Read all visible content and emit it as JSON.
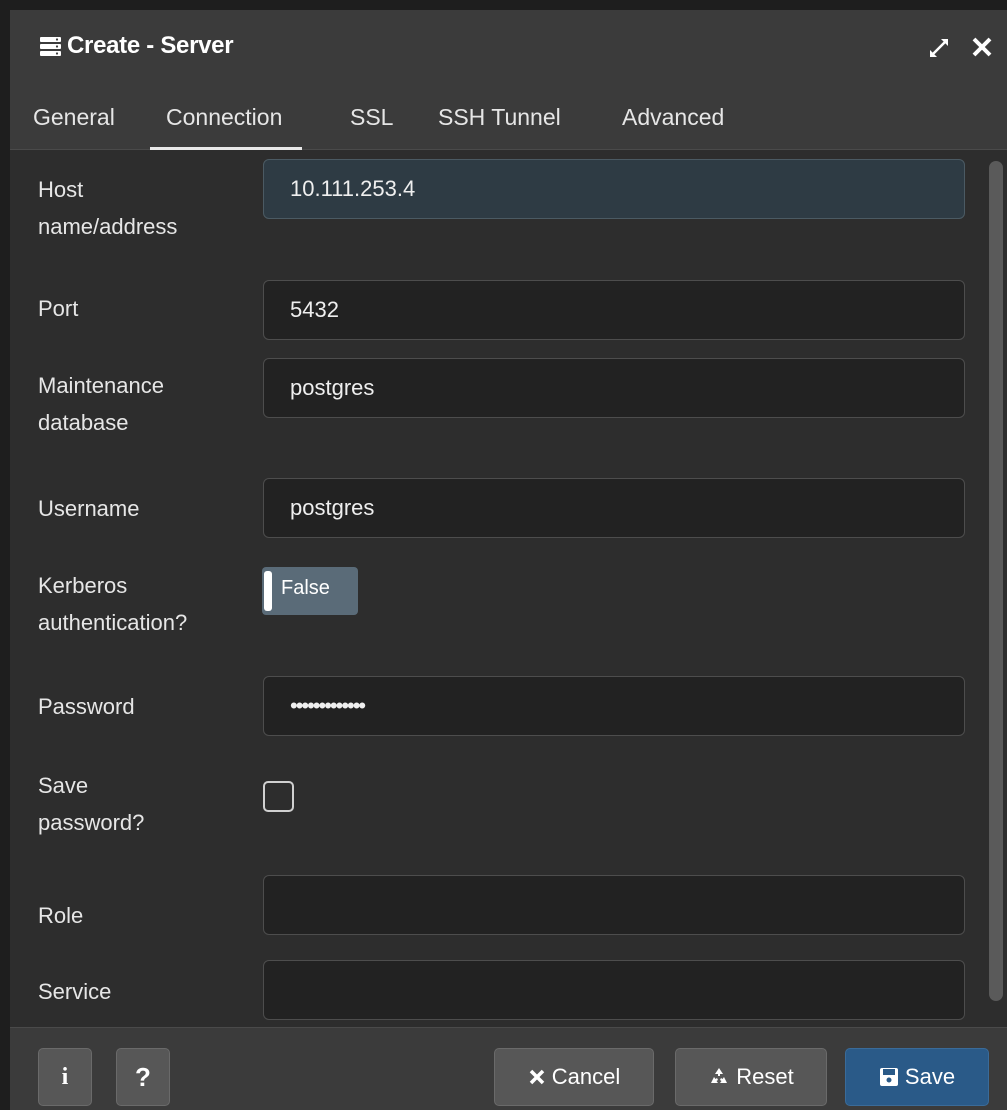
{
  "dialog": {
    "title": "Create - Server"
  },
  "tabs": [
    {
      "label": "General",
      "active": false
    },
    {
      "label": "Connection",
      "active": true
    },
    {
      "label": "SSL",
      "active": false
    },
    {
      "label": "SSH Tunnel",
      "active": false
    },
    {
      "label": "Advanced",
      "active": false
    }
  ],
  "form": {
    "host_label_line1": "Host",
    "host_label_line2": "name/address",
    "host_value": "10.111.253.4",
    "port_label": "Port",
    "port_value": "5432",
    "maintenance_label_line1": "Maintenance",
    "maintenance_label_line2": "database",
    "maintenance_value": "postgres",
    "username_label": "Username",
    "username_value": "postgres",
    "kerberos_label_line1": "Kerberos",
    "kerberos_label_line2": "authentication?",
    "kerberos_value": "False",
    "password_label": "Password",
    "password_value": "•••••••••••••",
    "save_password_label_line1": "Save",
    "save_password_label_line2": "password?",
    "save_password_checked": false,
    "role_label": "Role",
    "role_value": "",
    "service_label": "Service",
    "service_value": ""
  },
  "footer": {
    "info_label": "i",
    "help_label": "?",
    "cancel_label": "Cancel",
    "reset_label": "Reset",
    "save_label": "Save"
  },
  "colors": {
    "background": "#2d2d2d",
    "header": "#3b3b3b",
    "input_bg": "#222222",
    "focused_input_bg": "#2e3b44",
    "toggle_bg": "#5a6b78",
    "primary": "#2a5a88"
  }
}
